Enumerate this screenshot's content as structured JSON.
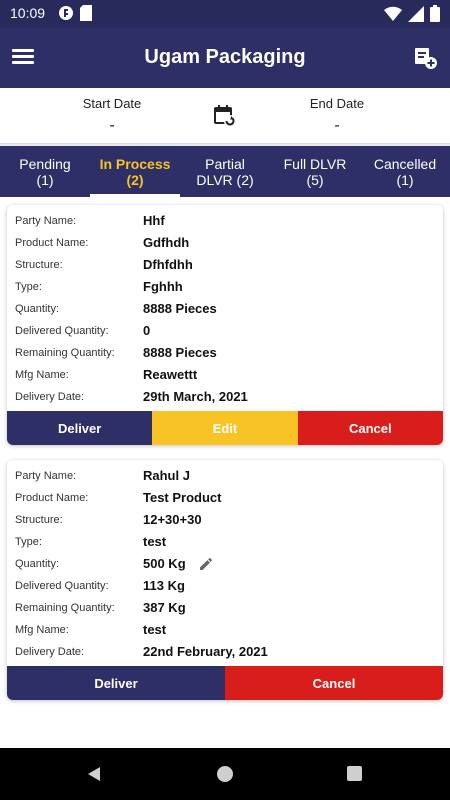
{
  "status_bar": {
    "time": "10:09",
    "icons": [
      "app-notification-icon",
      "sd-card-icon",
      "wifi-icon",
      "signal-icon",
      "battery-icon"
    ]
  },
  "header": {
    "title": "Ugam Packaging",
    "menu_icon": "menu-icon",
    "action_icon": "report-icon"
  },
  "date_filter": {
    "start_label": "Start Date",
    "start_value": "-",
    "end_label": "End Date",
    "end_value": "-",
    "icon": "calendar-refresh-icon"
  },
  "tabs": [
    {
      "label": "Pending",
      "count": "(1)",
      "active": false
    },
    {
      "label": "In Process",
      "count": "(2)",
      "active": true
    },
    {
      "label": "Partial",
      "count": "DLVR (2)",
      "active": false
    },
    {
      "label": "Full DLVR",
      "count": "(5)",
      "active": false
    },
    {
      "label": "Cancelled",
      "count": "(1)",
      "active": false
    }
  ],
  "orders": [
    {
      "fields": [
        {
          "label": "Party Name:",
          "value": "Hhf"
        },
        {
          "label": "Product Name:",
          "value": "Gdfhdh"
        },
        {
          "label": "Structure:",
          "value": "Dfhfdhh"
        },
        {
          "label": "Type:",
          "value": "Fghhh"
        },
        {
          "label": "Quantity:",
          "value": "8888 Pieces"
        },
        {
          "label": "Delivered Quantity:",
          "value": "0"
        },
        {
          "label": "Remaining Quantity:",
          "value": "8888 Pieces"
        },
        {
          "label": "Mfg Name:",
          "value": "Reawettt"
        },
        {
          "label": "Delivery Date:",
          "value": "29th March, 2021"
        }
      ],
      "buttons": {
        "deliver": "Deliver",
        "edit": "Edit",
        "cancel": "Cancel"
      }
    },
    {
      "fields": [
        {
          "label": "Party Name:",
          "value": "Rahul J"
        },
        {
          "label": "Product Name:",
          "value": "Test Product"
        },
        {
          "label": "Structure:",
          "value": "12+30+30"
        },
        {
          "label": "Type:",
          "value": "test"
        },
        {
          "label": "Quantity:",
          "value": "500 Kg"
        },
        {
          "label": "Delivered Quantity:",
          "value": "113 Kg"
        },
        {
          "label": "Remaining Quantity:",
          "value": "387 Kg"
        },
        {
          "label": "Mfg Name:",
          "value": "test"
        },
        {
          "label": "Delivery Date:",
          "value": "22nd February, 2021"
        }
      ],
      "buttons": {
        "deliver": "Deliver",
        "cancel": "Cancel"
      }
    }
  ],
  "colors": {
    "primary": "#2d2f66",
    "accent": "#f7c325",
    "danger": "#d91d1b"
  },
  "nav": {
    "back_icon": "back-icon",
    "home_icon": "home-icon",
    "recents_icon": "recents-icon"
  }
}
